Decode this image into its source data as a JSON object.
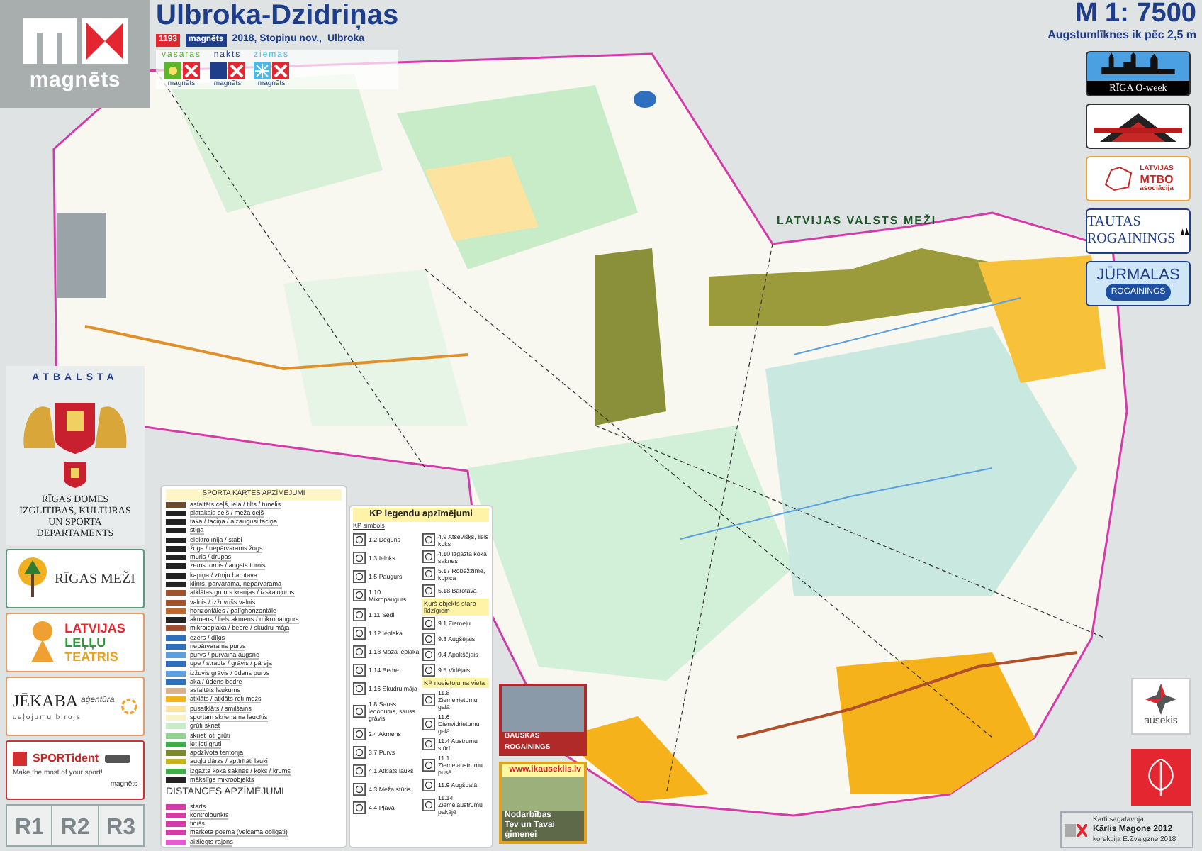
{
  "brand": {
    "logo": "magnēts"
  },
  "header": {
    "title": "Ulbroka-Dzidriņas",
    "event_number": "1193",
    "series_logo": "magnēts",
    "details": "2018, Stopiņu nov.,",
    "place": "Ulbroka",
    "series": [
      {
        "name": "vasaras",
        "logo": "magnēts",
        "kind": "sun"
      },
      {
        "name": "nakts",
        "logo": "magnēts",
        "kind": "moon"
      },
      {
        "name": "ziemas",
        "logo": "magnēts",
        "kind": "snow"
      }
    ]
  },
  "scale": {
    "ratio": "M 1: 7500",
    "contours": "Augstumlīknes ik pēc 2,5 m"
  },
  "map": {
    "label": "LATVIJAS VALSTS MEŽI"
  },
  "support": {
    "heading": "ATBALSTA",
    "department": "RĪGAS DOMES IZGLĪTĪBAS, KULTŪRAS UN SPORTA DEPARTAMENTS",
    "cards": [
      {
        "kind": "forest",
        "lines": [
          "RĪGAS MEŽI"
        ]
      },
      {
        "kind": "theatre",
        "lines": [
          "LATVIJAS",
          "LEĻĻU",
          "TEATRIS"
        ]
      },
      {
        "kind": "agency",
        "lines": [
          "JĒKABA",
          "aģentūra",
          "ceļojumu birojs"
        ]
      },
      {
        "kind": "sportident",
        "lines": [
          "SPORTident",
          "Make the most of your sport!",
          "magnēts"
        ]
      }
    ]
  },
  "rounds": [
    "R1",
    "R2",
    "R3"
  ],
  "sport_legend": {
    "title": "SPORTA KARTES APZĪMĒJUMI",
    "items": [
      {
        "text": "asfaltēts ceļš, iela / tilts / tunelis",
        "color": "#6b4b2a"
      },
      {
        "text": "platākais ceļš / meža ceļš",
        "color": "#222222"
      },
      {
        "text": "taka / taciņa / aizaugusi taciņa",
        "color": "#222222"
      },
      {
        "text": "stiga",
        "color": "#222222"
      },
      {
        "text": "elektrolīnija / stabi",
        "color": "#222222"
      },
      {
        "text": "žogs / nepārvarams žogs",
        "color": "#222222"
      },
      {
        "text": "mūris / drupas",
        "color": "#222222"
      },
      {
        "text": "zems tornis / augsts tornis",
        "color": "#222222"
      },
      {
        "text": "kapiņa / zīmju barotava",
        "color": "#222222"
      },
      {
        "text": "klints, pārvarama, nepārvarama",
        "color": "#222222"
      },
      {
        "text": "atklātas grunts kraujas / izskalojums",
        "color": "#a0522d"
      },
      {
        "text": "valnis / izžuvušs valnis",
        "color": "#a0522d"
      },
      {
        "text": "horizontāles / palīghorizontāle",
        "color": "#c0692f"
      },
      {
        "text": "akmens / liels akmens / mikropaugurs",
        "color": "#222222"
      },
      {
        "text": "mikroieplaka / bedre / skudru māja",
        "color": "#a0522d"
      },
      {
        "text": "ezers / dīķis",
        "color": "#2f6fc0"
      },
      {
        "text": "nepārvarams purvs",
        "color": "#2f6fc0"
      },
      {
        "text": "purvs / purvaina augsne",
        "color": "#5aa0e0"
      },
      {
        "text": "upe / strauts / grāvis / pāreja",
        "color": "#2f6fc0"
      },
      {
        "text": "izžuvis grāvis / ūdens purvs",
        "color": "#5aa0e0"
      },
      {
        "text": "aka / ūdens bedre",
        "color": "#2f6fc0"
      },
      {
        "text": "asfaltēts laukums",
        "color": "#d9b48f"
      },
      {
        "text": "atklāts / atklāts reti mežs",
        "color": "#f6b21b"
      },
      {
        "text": "pusatklāts / smilšains",
        "color": "#fde3a0"
      },
      {
        "text": "sportam skrienama laucītis",
        "color": "#f9f3c8"
      },
      {
        "text": "grūti skriet",
        "color": "#c8ecc8"
      },
      {
        "text": "skriet ļoti grūti",
        "color": "#8fd48f"
      },
      {
        "text": "iet ļoti grūti",
        "color": "#3fae4a"
      },
      {
        "text": "apdzīvota teritorija",
        "color": "#7a8a2a"
      },
      {
        "text": "augļu dārzs / aptīrītāti lauki",
        "color": "#c8b420"
      },
      {
        "text": "izgāzta koka saknes / koks / krūms",
        "color": "#3fae4a"
      },
      {
        "text": "mākslīgs mikroobjekts",
        "color": "#222222"
      }
    ],
    "distance_title": "DISTANCES APZĪMĒJUMI",
    "distance_items": [
      {
        "text": "starts",
        "color": "#d43ba8"
      },
      {
        "text": "kontrolpunkts",
        "color": "#d43ba8"
      },
      {
        "text": "finišs",
        "color": "#d43ba8"
      },
      {
        "text": "marķēta posma (veicama obligāti)",
        "color": "#d43ba8"
      },
      {
        "text": "aizliegts rajons",
        "color": "#e85ad0"
      }
    ]
  },
  "kp_legend": {
    "title": "KP legendu apzīmējumi",
    "subtitle": "KP simbols",
    "symbols": [
      "1.2 Deguns",
      "1.3 Ieloks",
      "1.5 Paugurs",
      "1.10 Mikropaugurs",
      "1.11 Sedli",
      "1.12 Ieplaka",
      "1.13 Maza ieplaka",
      "1.14 Bedre",
      "1.16 Skudru māja",
      "1.8 Sauss iedobums, sauss grāvis",
      "2.4 Akmens",
      "3.7 Purvs",
      "4.1 Atklāts lauks",
      "4.3 Meža stūris",
      "4.4 Pļava"
    ],
    "symbols_2": [
      "4.9 Atsevišķs, liels koks",
      "4.10 Izgāzta koka saknes",
      "5.17 Robežzīme, kupica",
      "5.18 Barotava"
    ],
    "which_title": "Kurš objekts starp līdzīgiem",
    "which": [
      "9.1 Ziemeļu",
      "9.3 Augšējais",
      "9.4 Apakšējais",
      "9.5 Vidējais"
    ],
    "location_title": "KP novietojuma vieta",
    "location": [
      "11.8 Ziemeļrietumu galā",
      "11.6 Dienvidrietumu galā",
      "11.4 Austrumu stūrī",
      "11.1 Ziemeļaustrumu pusē",
      "11.9 Augšdaļā",
      "11.14 Ziemeļaustrumu pakājē"
    ]
  },
  "ads": [
    {
      "kind": "castle",
      "caption": "BAUSKAS ROGAININGS"
    },
    {
      "kind": "school",
      "url": "www.ikauseklis.lv",
      "lines": [
        "Nodarbības",
        "Tev un Tavai ģimenei"
      ]
    }
  ],
  "events": [
    {
      "kind": "oweek",
      "text": "RĪGA O-week"
    },
    {
      "kind": "pyramid"
    },
    {
      "kind": "mtbo",
      "lines": [
        "LATVIJAS",
        "MTBO",
        "asociācija"
      ]
    },
    {
      "kind": "tautas",
      "lines": [
        "TAUTAS",
        "ROGAININGS"
      ]
    },
    {
      "kind": "jurmalas",
      "lines": [
        "JŪRMALAS",
        "ROGAININGS"
      ]
    }
  ],
  "partners": [
    {
      "kind": "star",
      "text": "ausekis"
    },
    {
      "kind": "tree"
    }
  ],
  "credits": {
    "label": "Karti sagatavoja:",
    "author": "Kārlis Magone 2012",
    "correction": "korekcija E.Zvaigzne 2018"
  }
}
